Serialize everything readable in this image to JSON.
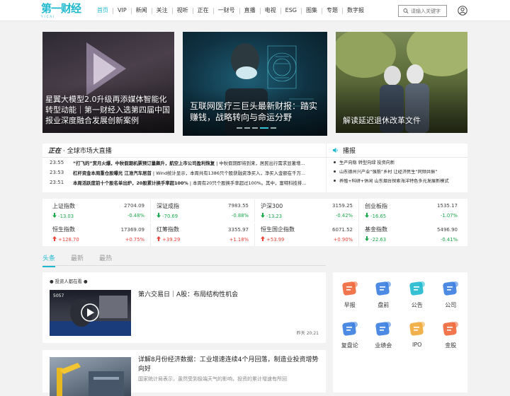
{
  "header": {
    "logo_text": "第一财经",
    "logo_sub": "YICAI",
    "menu": [
      "首页",
      "VIP",
      "新闻",
      "关注",
      "视听",
      "正在",
      "一财号",
      "直播",
      "电视",
      "ESG",
      "图集",
      "专题",
      "数字报"
    ],
    "search_placeholder": "请输入关键字",
    "icons": [
      "search-icon",
      "user-icon"
    ]
  },
  "carousel": {
    "slides": [
      {
        "caption": "星翼大模型2.0升级再添媒体智能化转型动能｜第一财经入选第四届中国报业深度融合发展创新案例"
      },
      {
        "caption": "互联网医疗三巨头最新财报：踏实赚钱，战略转向与命运分野"
      },
      {
        "caption": "解读延迟退休改革文件"
      }
    ],
    "active_dot": 3,
    "dot_count": 5
  },
  "ticker": {
    "title_logo": "正在",
    "title": "· 全球市场大直播",
    "rows": [
      {
        "time": "23:55",
        "bold": "“打飞的”赏月火爆，中秋假期机票预订量飙升，航空上市公司盈利恢复",
        "rest": " | 中秋假期即将到来，居民出行需求显著增..."
      },
      {
        "time": "23:53",
        "bold": "杠杆资金本周重仓股曝光 江淮汽车居首",
        "rest": " | Wind统计显示，本周共有1386只个股获融资净买入，净买入金额在千万..."
      },
      {
        "time": "23:51",
        "bold": "本周活跃度前十个股名单出炉，20股累计换手率超100%",
        "rest": " | 本周有20只个股换手率超过100%。其中，富特科技排..."
      }
    ]
  },
  "broadcast": {
    "title": "播报",
    "items": [
      "生产向稳 转型向绿 投资向新",
      "山东德州兴产业“强筋”乡村 让经济民生“同频共振”",
      "养殖+科研+休闲 山东烟台探索海洋特色多元发展新模式"
    ]
  },
  "indices": [
    {
      "name": "上证指数",
      "value": "2704.09",
      "change": "-13.03",
      "pct": "-0.48%",
      "dir": "down"
    },
    {
      "name": "深证成指",
      "value": "7983.55",
      "change": "-70.69",
      "pct": "-0.88%",
      "dir": "down"
    },
    {
      "name": "沪深300",
      "value": "3159.25",
      "change": "-13.23",
      "pct": "-0.42%",
      "dir": "down"
    },
    {
      "name": "创业板指",
      "value": "1535.17",
      "change": "-16.65",
      "pct": "-1.07%",
      "dir": "down"
    },
    {
      "name": "恒生指数",
      "value": "17369.09",
      "change": "+128.70",
      "pct": "+0.75%",
      "dir": "up"
    },
    {
      "name": "红筹指数",
      "value": "3355.97",
      "change": "+39.29",
      "pct": "+1.18%",
      "dir": "up"
    },
    {
      "name": "恒生国企指数",
      "value": "6071.52",
      "change": "+53.99",
      "pct": "+0.90%",
      "dir": "up"
    },
    {
      "name": "基金指数",
      "value": "5496.90",
      "change": "-22.63",
      "pct": "-0.41%",
      "dir": "down"
    }
  ],
  "feed_tabs": [
    "头条",
    "最新",
    "最热"
  ],
  "feed": [
    {
      "section": "投资人都在看",
      "title": "第六交易日｜A股：布局结构性机会",
      "time": "昨天 20:21",
      "thumb_text": "5057"
    },
    {
      "title": "详解8月份经济数据：工业增速连续4个月回落，制造业投资增势向好",
      "summary": "国家统计局表示，虽然受到极端天气的影响，投资的累计增速有所回"
    }
  ],
  "apps": [
    {
      "label": "早报",
      "icon": "morning-news-icon",
      "color": "#f0663a"
    },
    {
      "label": "盘前",
      "icon": "pre-market-icon",
      "color": "#3a7de0"
    },
    {
      "label": "公告",
      "icon": "announcement-icon",
      "color": "#1fb9cf"
    },
    {
      "label": "公司",
      "icon": "company-icon",
      "color": "#3a7de0"
    },
    {
      "label": "复盘论",
      "icon": "review-icon",
      "color": "#3a7de0"
    },
    {
      "label": "业绩会",
      "icon": "earnings-call-icon",
      "color": "#3a7de0"
    },
    {
      "label": "IPO",
      "icon": "ipo-icon",
      "color": "#f0a83a"
    },
    {
      "label": "金股",
      "icon": "gold-stock-icon",
      "color": "#f0663a"
    }
  ],
  "colors": {
    "accent": "#1fb9cf",
    "up": "#e8433b",
    "down": "#1ba94c"
  }
}
